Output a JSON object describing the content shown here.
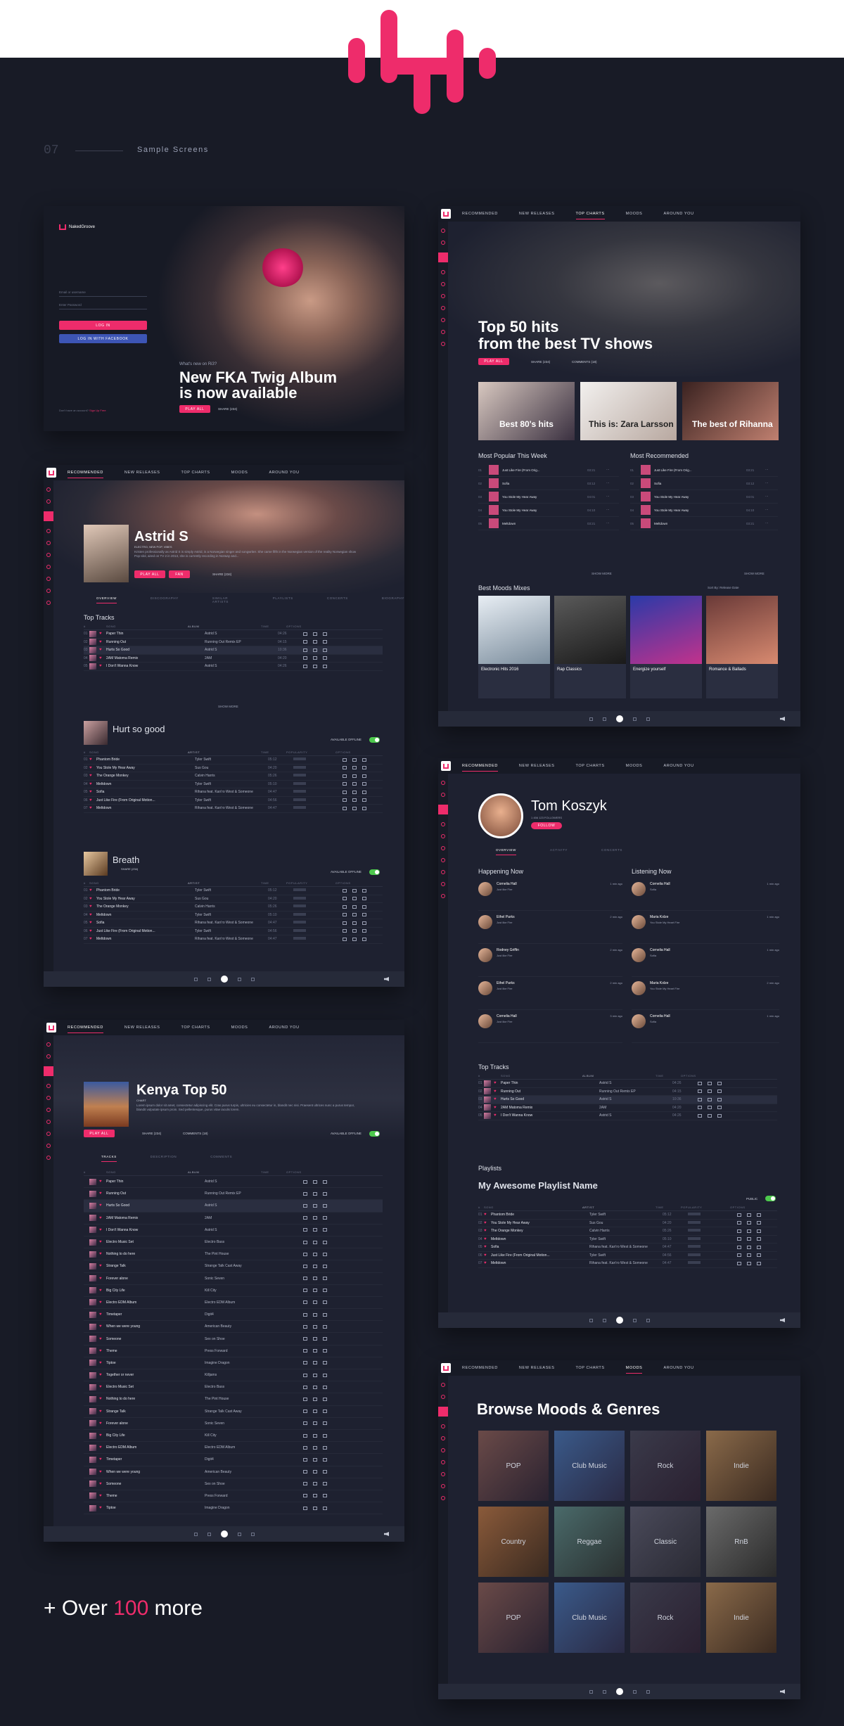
{
  "brand": {
    "accent": "#ee2c6b",
    "bg": "#181b26",
    "panel": "#1e2130"
  },
  "section": {
    "number": "07",
    "title": "Sample Screens"
  },
  "login": {
    "logo_text": "NakedGroove",
    "email_placeholder": "Email or username",
    "password_placeholder": "Enter Password",
    "login_label": "LOG IN",
    "facebook_label": "LOG IN WITH FACEBOOK",
    "footer_text": "Don't have an account?",
    "footer_link": "Sign Up Free",
    "kicker": "What's new on Ri3?",
    "title_line1": "New FKA Twig Album",
    "title_line2": "is now available",
    "play_label": "PLAY ALL",
    "share_label": "SHARE (234)"
  },
  "nav": {
    "recommended": "RECOMMENDED",
    "new_releases": "NEW RELEASES",
    "top_charts": "TOP CHARTS",
    "moods": "MOODS",
    "around_you": "AROUND YOU"
  },
  "charts": {
    "title_line1": "Top 50 hits",
    "title_line2": "from the best TV shows",
    "play_label": "PLAY ALL",
    "share_label": "SHARE (234)",
    "comments_label": "COMMENTS (18)",
    "playlists": [
      {
        "title": "Best 80's hits"
      },
      {
        "title": "This is: Zara Larsson"
      },
      {
        "title": "The best of Rihanna"
      }
    ],
    "popular_title": "Most Popular This Week",
    "recommended_title": "Most Recommended",
    "popular": [
      {
        "n": "01",
        "name": "Just Like Fire (From Orig...",
        "time": "03:21"
      },
      {
        "n": "02",
        "name": "Sofia",
        "time": "03:12"
      },
      {
        "n": "03",
        "name": "You Stole My Hear Away",
        "time": "04:01"
      },
      {
        "n": "04",
        "name": "You Stole My Hear Away",
        "time": "04:10"
      },
      {
        "n": "05",
        "name": "Meltdown",
        "time": "03:21"
      }
    ],
    "recommended": [
      {
        "n": "01",
        "name": "Just Like Fire (From Orig...",
        "time": "03:21"
      },
      {
        "n": "02",
        "name": "Sofia",
        "time": "03:12"
      },
      {
        "n": "03",
        "name": "You Stole My Hear Away",
        "time": "04:01"
      },
      {
        "n": "04",
        "name": "You Stole My Hear Away",
        "time": "04:10"
      },
      {
        "n": "05",
        "name": "Meltdown",
        "time": "03:21"
      }
    ],
    "show_more": "SHOW MORE",
    "moods_title": "Best Moods Mixes",
    "sort_label": "Sort By: Release Date",
    "moods": [
      {
        "title": "Electronic Hits 2016"
      },
      {
        "title": "Rap Classics"
      },
      {
        "title": "Energize yourself"
      },
      {
        "title": "Romance & Ballads"
      }
    ]
  },
  "artist": {
    "name": "Astrid S",
    "genres": "ELECTRO, NEW POP, VIBES",
    "bio": "Kristen professionally as Astrid S is simply Astrid, is a Norwegian singer and songwriter. She came fifth in the Norwegian version of the reality Norwegian show Pop Idol, aired on TV 2 in 2013, she is currently recording in Norway and...",
    "play_label": "PLAY ALL",
    "fan_label": "FAN",
    "share_label": "SHARE (234)",
    "tabs": [
      "OVERVIEW",
      "DISCOGRAPHY",
      "SIMILAR ARTISTS",
      "PLAYLISTS",
      "CONCERTS",
      "BIOGRAPHY"
    ],
    "top_tracks_title": "Top Tracks",
    "cols": [
      "#",
      "SONG",
      "ALBUM",
      "TIME",
      "OPTIONS"
    ],
    "top_tracks": [
      {
        "n": "01",
        "name": "Paper Thin",
        "album": "Astrid S",
        "time": "04:26"
      },
      {
        "n": "02",
        "name": "Running Out",
        "album": "Running Out Remix EP",
        "time": "04:15"
      },
      {
        "n": "03",
        "name": "Hurts So Good",
        "album": "Astrid S",
        "time": "10:36"
      },
      {
        "n": "04",
        "name": "2AM Matoma Remix",
        "album": "2AM",
        "time": "04:20"
      },
      {
        "n": "05",
        "name": "I Don't Wanna Know",
        "album": "Astrid S",
        "time": "04:26"
      }
    ],
    "show_more": "SHOW MORE",
    "album1": {
      "title": "Hurt so good",
      "offline": "AVAILABLE OFFLINE"
    },
    "album2": {
      "title": "Breath",
      "share": "SHARE (234)",
      "offline": "AVAILABLE OFFLINE"
    },
    "album_cols": [
      "#",
      "SONG",
      "ARTIST",
      "TIME",
      "POPULARITY",
      "OPTIONS"
    ],
    "album_tracks": [
      {
        "n": "01",
        "name": "Phantom Bride",
        "artist": "Tyler Swift",
        "time": "05:12"
      },
      {
        "n": "02",
        "name": "You Stole My Hear Away",
        "artist": "Sus Gou",
        "time": "04:20"
      },
      {
        "n": "03",
        "name": "The Orange Monkey",
        "artist": "Calvin Harris",
        "time": "05:26"
      },
      {
        "n": "04",
        "name": "Meltdown",
        "artist": "Tyler Swift",
        "time": "05:10"
      },
      {
        "n": "05",
        "name": "Sofia",
        "artist": "Rihana feat. Kan'ro West & Someone",
        "time": "04:47"
      },
      {
        "n": "06",
        "name": "Just Like Fire (From Original Motion...",
        "artist": "Tyler Swift",
        "time": "04:56"
      },
      {
        "n": "07",
        "name": "Meltdown",
        "artist": "Rihana feat. Kan'ro West & Someone",
        "time": "04:47"
      }
    ]
  },
  "profile": {
    "name": "Tom Koszyk",
    "followers": "1 456 123  FOLLOWERS",
    "follow_label": "FOLLOW",
    "tabs": [
      "OVERVIEW",
      "ACTIVITY",
      "CONCERTS"
    ],
    "happening_title": "Happening Now",
    "listening_title": "Listening Now",
    "happening": [
      {
        "user": "Cornelia Hall",
        "track": "Just like Fire",
        "time": "1 min ago"
      },
      {
        "user": "Ethel Parks",
        "track": "Just like Fire",
        "time": "2 min ago"
      },
      {
        "user": "Rodney Griffin",
        "track": "Just like Fire",
        "time": "2 min ago"
      },
      {
        "user": "Ethel Parks",
        "track": "Just like Fire",
        "time": "2 min ago"
      },
      {
        "user": "Cornelia Hall",
        "track": "Just like Fire",
        "time": "3 min ago"
      }
    ],
    "listening": [
      {
        "user": "Cornelia Hall",
        "track": "Sofia",
        "time": "1 min ago"
      },
      {
        "user": "Maria Kolze",
        "track": "You Stole My Heart Fire",
        "time": "1 min ago"
      },
      {
        "user": "Cornelia Hall",
        "track": "Sofia",
        "time": "1 min ago"
      },
      {
        "user": "Maria Kolze",
        "track": "You Stole My Heart Fire",
        "time": "2 min ago"
      },
      {
        "user": "Cornelia Hall",
        "track": "Sofia",
        "time": "1 min ago"
      }
    ],
    "top_tracks_title": "Top Tracks",
    "playlists_title": "Playlists",
    "playlist_name": "My Awesome Playlist Name",
    "public_label": "PUBLIC"
  },
  "kenya": {
    "title": "Kenya Top 50",
    "type": "CHART",
    "desc": "Lorem ipsum dolor sit amet, consectetur adipiscing elit. Cras purus turpis, ultricies eu consectetur in, blandit nec nisi. Praesent ultrices nunc a purus tempor, blandit vulputate ipsum proin. Sed pellentesque, purus vitae iaculis lorem.",
    "play_label": "PLAY ALL",
    "share_label": "SHARE (234)",
    "comments_label": "COMMENTS (18)",
    "offline": "AVAILABLE OFFLINE",
    "tabs": [
      "TRACKS",
      "DESCRIPTION",
      "COMMENTS"
    ],
    "tracks": [
      "Paper Thin",
      "Running Out",
      "Hurts So Good",
      "2AM Matoma Remix",
      "I Don't Wanna Know",
      "Electro Music Set",
      "Nothing to do here",
      "Strange Talk",
      "Forever alone",
      "Big City Life",
      "Electro EDM Album",
      "Timetaper",
      "When we were young",
      "Someone",
      "Theme",
      "Tiptoe",
      "Together or never",
      "Electro Music Set",
      "Nothing to do here",
      "Strange Talk",
      "Forever alone",
      "Big City Life",
      "Electro EDM Album",
      "Timetaper",
      "When we were young",
      "Someone",
      "Theme",
      "Tiptoe"
    ],
    "albums": [
      "Astrid S",
      "Running Out Remix EP",
      "Astrid S",
      "2AM",
      "Astrid S",
      "Electro Bass",
      "The Pint House",
      "Strange Talk Cast Away",
      "Sonic Seven",
      "Kill City",
      "Electro EDM Album",
      "Digit4",
      "American Beauty",
      "Sex on Shoe",
      "Press Forward",
      "Imagine Dragon",
      "Killjams",
      "Electro Bass",
      "The Pint House",
      "Strange Talk Cast Away",
      "Sonic Seven",
      "Kill City",
      "Electro EDM Album",
      "Digit4",
      "American Beauty",
      "Sex on Shoe",
      "Press Forward",
      "Imagine Dragon"
    ]
  },
  "moods": {
    "title": "Browse Moods & Genres",
    "genres": [
      "POP",
      "Club Music",
      "Rock",
      "Indie",
      "Country",
      "Reggae",
      "Classic",
      "RnB",
      "POP",
      "Club Music",
      "Rock",
      "Indie"
    ]
  },
  "footer": {
    "prefix": "+ Over ",
    "number": "100",
    "suffix": " more"
  }
}
